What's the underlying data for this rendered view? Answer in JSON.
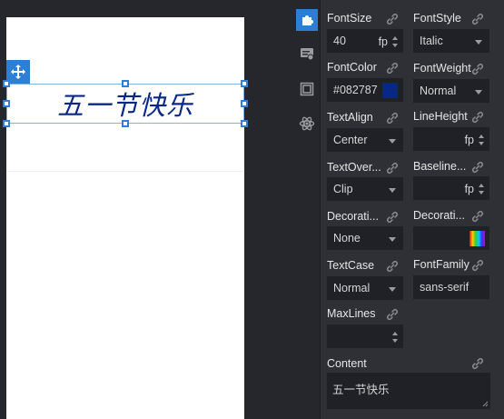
{
  "canvas": {
    "text_element": {
      "text": "五一节快乐",
      "color": "#082787"
    }
  },
  "colors": {
    "accent": "#2d7fd6",
    "panel_bg": "#2e3036",
    "field_bg": "#1f2126",
    "font_color_swatch": "#082787"
  },
  "sidebar": {
    "items": [
      {
        "icon": "puzzle-icon",
        "active": true
      },
      {
        "icon": "list-settings-icon",
        "active": false
      },
      {
        "icon": "frame-icon",
        "active": false
      },
      {
        "icon": "atom-icon",
        "active": false
      }
    ]
  },
  "props": {
    "font_size": {
      "label": "FontSize",
      "value": "40",
      "unit": "fp"
    },
    "font_style": {
      "label": "FontStyle",
      "value": "Italic"
    },
    "font_color": {
      "label": "FontColor",
      "value": "#082787"
    },
    "font_weight": {
      "label": "FontWeight",
      "value": "Normal"
    },
    "text_align": {
      "label": "TextAlign",
      "value": "Center"
    },
    "line_height": {
      "label": "LineHeight",
      "value": "",
      "unit": "fp"
    },
    "text_overflow": {
      "label": "TextOver...",
      "value": "Clip"
    },
    "baseline": {
      "label": "Baseline...",
      "value": "",
      "unit": "fp"
    },
    "decoration_type": {
      "label": "Decorati...",
      "value": "None"
    },
    "decoration_color": {
      "label": "Decorati..."
    },
    "text_case": {
      "label": "TextCase",
      "value": "Normal"
    },
    "font_family": {
      "label": "FontFamily",
      "value": "sans-serif"
    },
    "max_lines": {
      "label": "MaxLines",
      "value": ""
    },
    "content": {
      "label": "Content",
      "value": "五一节快乐"
    }
  }
}
